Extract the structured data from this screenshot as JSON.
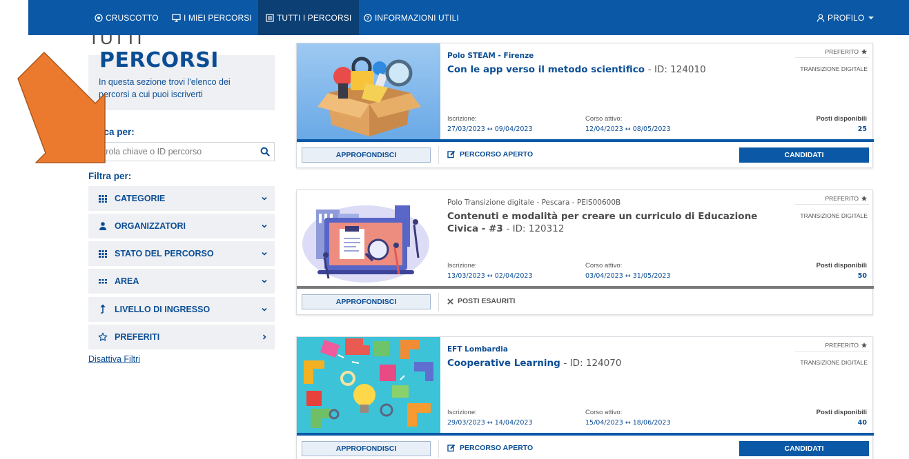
{
  "colors": {
    "nav_bg": "#0a58a6",
    "nav_active_bg": "#0c3f74",
    "primary_blue": "#0b4d94",
    "panel_bg": "#eef0f3",
    "arrow_orange": "#ec7a2e"
  },
  "nav": {
    "dashboard": "CRUSCOTTO",
    "my_courses": "I MIEI PERCORSI",
    "all_courses": "TUTTI I PERCORSI",
    "info": "INFORMAZIONI UTILI",
    "profile": "PROFILO"
  },
  "sidebar": {
    "title_line1": "TUTTI",
    "title_line2": "PERCORSI",
    "intro": "In questa sezione trovi l'elenco dei percorsi a cui puoi iscriverti",
    "search_label": "Cerca per:",
    "search_placeholder": "Parola chiave o ID percorso",
    "filter_label": "Filtra per:",
    "filters": [
      {
        "label": "CATEGORIE",
        "icon": "grid-icon"
      },
      {
        "label": "ORGANIZZATORI",
        "icon": "users-icon"
      },
      {
        "label": "STATO DEL PERCORSO",
        "icon": "grid-icon"
      },
      {
        "label": "AREA",
        "icon": "dots-icon"
      },
      {
        "label": "LIVELLO DI INGRESSO",
        "icon": "level-icon"
      },
      {
        "label": "PREFERITI",
        "icon": "star-icon"
      }
    ],
    "disable_filters": "Disattiva Filtri"
  },
  "cards": [
    {
      "polo": "Polo STEAM - Firenze",
      "title": "Con le app verso il metodo scientifico",
      "id_text": "- ID: 124010",
      "favorite": "PREFERITO",
      "tag": "TRANSIZIONE DIGITALE",
      "enroll_label": "Iscrizione:",
      "enroll_dates": "27/03/2023 ↔ 09/04/2023",
      "active_label": "Corso attivo:",
      "active_dates": "12/04/2023 ↔ 08/05/2023",
      "seats_label": "Posti disponibili",
      "seats": "25",
      "more": "APPROFONDISCI",
      "status": "PERCORSO APERTO",
      "apply": "CANDIDATI"
    },
    {
      "polo": "Polo Transizione digitale - Pescara - PEIS00600B",
      "title": "Contenuti e modalità per creare un curriculo di Educazione Civica - #3",
      "id_text": "- ID: 120312",
      "favorite": "PREFERITO",
      "tag": "TRANSIZIONE DIGITALE",
      "enroll_label": "Iscrizione:",
      "enroll_dates": "13/03/2023 ↔ 02/04/2023",
      "active_label": "Corso attivo:",
      "active_dates": "03/04/2023 ↔ 31/05/2023",
      "seats_label": "Posti disponibili",
      "seats": "50",
      "more": "APPROFONDISCI",
      "status": "POSTI ESAURITI"
    },
    {
      "polo": "EFT Lombardia",
      "title": "Cooperative Learning",
      "id_text": "- ID: 124070",
      "favorite": "PREFERITO",
      "tag": "TRANSIZIONE DIGITALE",
      "enroll_label": "Iscrizione:",
      "enroll_dates": "29/03/2023 ↔ 14/04/2023",
      "active_label": "Corso attivo:",
      "active_dates": "15/04/2023 ↔ 18/06/2023",
      "seats_label": "Posti disponibili",
      "seats": "40",
      "more": "APPROFONDISCI",
      "status": "PERCORSO APERTO",
      "apply": "CANDIDATI"
    }
  ]
}
